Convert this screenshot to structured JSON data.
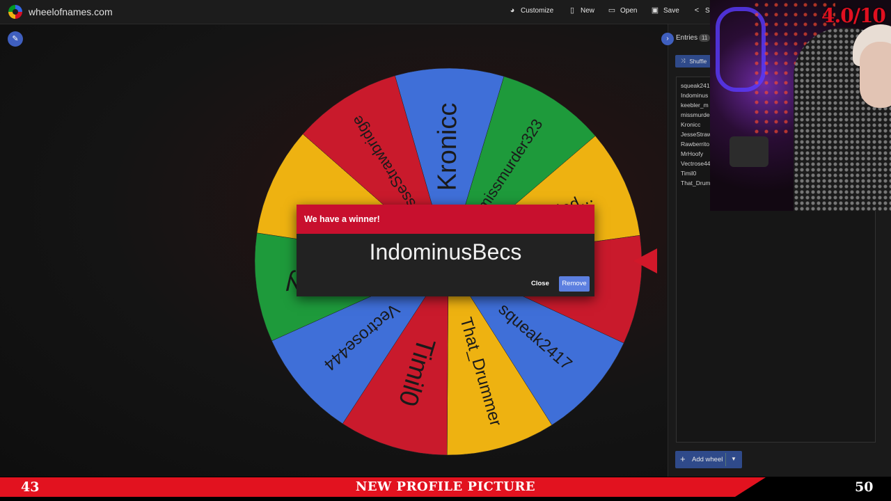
{
  "app": {
    "site_name": "wheelofnames.com"
  },
  "toolbar": {
    "customize": "Customize",
    "new": "New",
    "open": "Open",
    "save": "Save",
    "share": "S"
  },
  "wheel": {
    "segments": [
      {
        "label": "Kronicc",
        "color": "#3f6fd8"
      },
      {
        "label": "missmurder323",
        "color": "#1e9a3b"
      },
      {
        "label": "mctiddled...",
        "color": "#eeb211"
      },
      {
        "label": "IndominusBecs",
        "color": "#c91a2c"
      },
      {
        "label": "squeak2417",
        "color": "#3f6fd8"
      },
      {
        "label": "That_Drummer",
        "color": "#eeb211"
      },
      {
        "label": "Timil0",
        "color": "#c91a2c"
      },
      {
        "label": "Vectrose444",
        "color": "#3f6fd8"
      },
      {
        "label": "MrHoofy",
        "color": "#1e9a3b"
      },
      {
        "label": "Rawberrito",
        "color": "#eeb211"
      },
      {
        "label": "JesseStrawbridge",
        "color": "#c91a2c"
      }
    ],
    "visible_text": {
      "Kronicc": "Kronicc",
      "missmurder323": "missmurder323",
      "mctiddled...": "mctiddled...",
      "IndominusBecs": "sBecs",
      "squeak2417": "squeak2417",
      "That_Drummer": "That_Drummer",
      "Timil0": "Timil0",
      "Vectrose444": "Vectrose444",
      "MrHoofy": "MrHoofy",
      "Rawberrito": "rrito",
      "JesseStrawbridge": "esseStrawbridge"
    }
  },
  "dialog": {
    "title": "We have a winner!",
    "winner": "IndominusBecs",
    "close_label": "Close",
    "remove_label": "Remove"
  },
  "panel": {
    "tab_label": "Entries",
    "count": "11",
    "shuffle_label": "Shuffle",
    "entries": [
      "squeak241",
      "Indominus",
      "keebler_m",
      "missmurde",
      "Kronicc",
      "JesseStraw",
      "Rawberrito",
      "MrHoofy",
      "Vectrose44",
      "Timil0",
      "That_Drum"
    ],
    "add_wheel_label": "Add wheel"
  },
  "overlay": {
    "score": "4.0/10",
    "left_number": "43",
    "title": "NEW PROFILE PICTURE",
    "right_number": "50"
  }
}
